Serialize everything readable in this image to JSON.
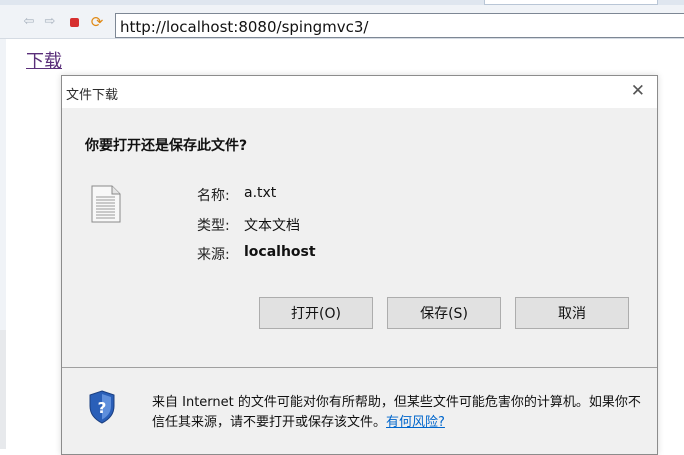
{
  "browser": {
    "address": "http://localhost:8080/spingmvc3/"
  },
  "page": {
    "download_link": "下载"
  },
  "dialog": {
    "title": "文件下载",
    "close_glyph": "✕",
    "question": "你要打开还是保存此文件?",
    "fields": {
      "name_label": "名称:",
      "name_value": "a.txt",
      "type_label": "类型:",
      "type_value": "文本文档",
      "source_label": "来源:",
      "source_value": "localhost"
    },
    "buttons": {
      "open": "打开(O)",
      "save": "保存(S)",
      "cancel": "取消"
    },
    "warning": {
      "text": "来自 Internet 的文件可能对你有所帮助，但某些文件可能危害你的计算机。如果你不信任其来源，请不要打开或保存该文件。",
      "link": "有何风险?"
    }
  },
  "icons": {
    "back": "back-arrow-icon",
    "forward": "forward-arrow-icon",
    "stop": "stop-icon",
    "refresh": "refresh-icon",
    "file": "text-file-icon",
    "shield": "security-shield-icon"
  },
  "colors": {
    "link_visited": "#5a2f7a",
    "risk_link": "#0066cc",
    "stop": "#d62f2f",
    "refresh": "#e08a16",
    "shield": "#2a5fb8"
  }
}
